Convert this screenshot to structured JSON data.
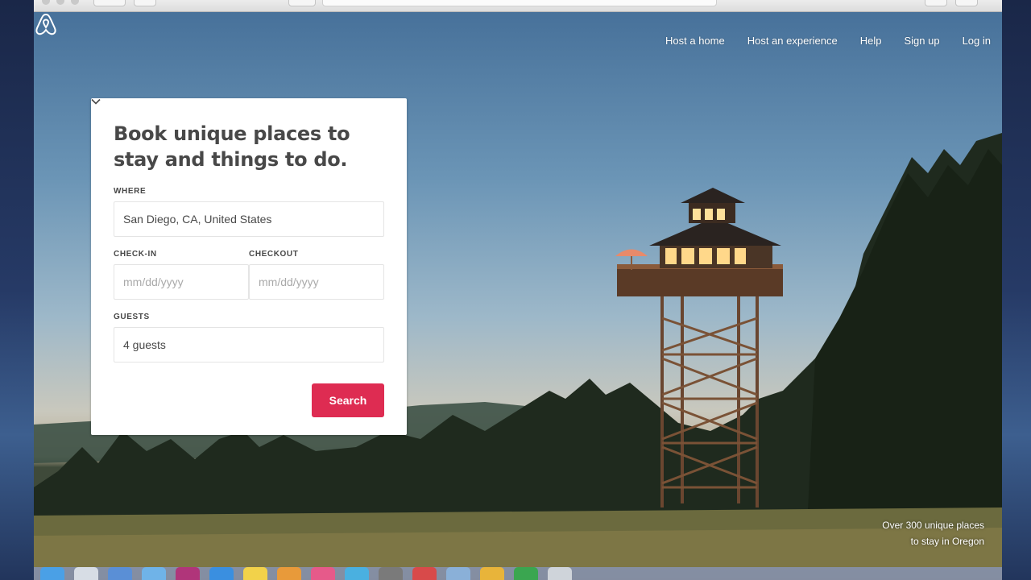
{
  "brand": {
    "logo_icon": "airbnb-logo-icon",
    "accent": "#de2c52"
  },
  "nav": {
    "items": [
      "Host a home",
      "Host an experience",
      "Help",
      "Sign up",
      "Log in"
    ]
  },
  "booking": {
    "title": "Book unique places to stay and things to do.",
    "where_label": "WHERE",
    "where_value": "San Diego, CA, United States",
    "checkin_label": "CHECK-IN",
    "checkin_placeholder": "mm/dd/yyyy",
    "checkout_label": "CHECKOUT",
    "checkout_placeholder": "mm/dd/yyyy",
    "guests_label": "GUESTS",
    "guests_value": "4 guests",
    "search_label": "Search"
  },
  "hero": {
    "caption_line1": "Over 300 unique places",
    "caption_line2": "to stay in Oregon"
  },
  "dock": {
    "icons": [
      "finder-icon",
      "safari-icon",
      "mail-icon",
      "calendar-icon",
      "itunes-icon",
      "appstore-icon",
      "notes-icon",
      "photos-icon",
      "music-icon",
      "messages-icon",
      "preview-icon",
      "maps-icon",
      "pages-icon",
      "numbers-icon",
      "keynote-icon",
      "trash-icon"
    ]
  }
}
